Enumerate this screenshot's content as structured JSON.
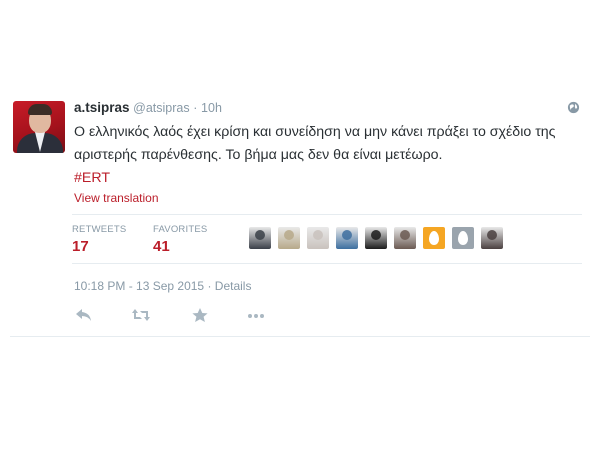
{
  "tweet": {
    "name": "a.tsipras",
    "handle": "@atsipras",
    "dot": "·",
    "time_ago": "10h",
    "text": "Ο ελληνικός λαός έχει κρίση και συνείδηση να μην κάνει πράξει το σχέδιο της αριστερής παρένθεσης. Το βήμα μας δεν θα είναι μετέωρο.",
    "hashtag": "#ERT",
    "view_translation": "View translation",
    "retweets_label": "RETWEETS",
    "retweets_count": "17",
    "favorites_label": "FAVORITES",
    "favorites_count": "41",
    "timestamp": "10:18 PM - 13 Sep 2015",
    "meta_separator": "·",
    "details": "Details"
  },
  "favoriters": [
    {
      "icon": "favoriter-avatar-1",
      "color": "#3a3f48"
    },
    {
      "icon": "favoriter-avatar-2",
      "color": "#b7a98a"
    },
    {
      "icon": "favoriter-avatar-3",
      "color": "#c9c2bd"
    },
    {
      "icon": "favoriter-avatar-4",
      "color": "#3d6f9f"
    },
    {
      "icon": "favoriter-avatar-5",
      "color": "#1c1c1c"
    },
    {
      "icon": "favoriter-avatar-6",
      "color": "#6b5a52"
    },
    {
      "icon": "default-egg-avatar-orange",
      "color": "#f5a623"
    },
    {
      "icon": "default-egg-avatar-grey",
      "color": "#9aa4ad"
    },
    {
      "icon": "favoriter-avatar-9",
      "color": "#4a4040"
    }
  ],
  "colors": {
    "accent": "#bb1e2a",
    "muted": "#8899a6",
    "text": "#292f33",
    "action_icon": "#aab8c2"
  },
  "actions": [
    "reply-icon",
    "retweet-icon",
    "favorite-icon",
    "more-icon"
  ]
}
